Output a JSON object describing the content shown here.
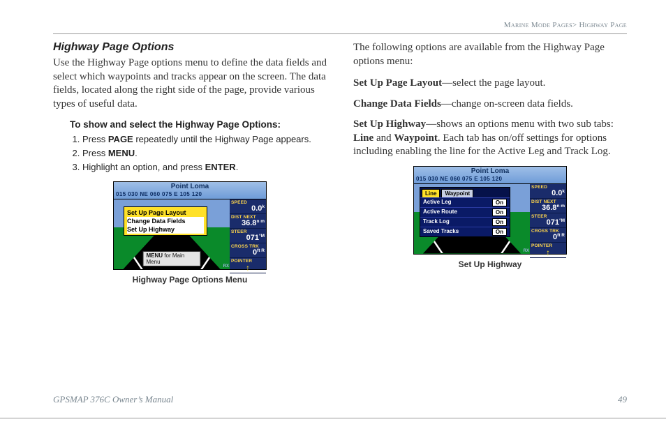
{
  "header": {
    "breadcrumb_left": "Marine Mode Pages",
    "breadcrumb_sep": ">",
    "breadcrumb_right": "Highway Page"
  },
  "left": {
    "title": "Highway Page Options",
    "intro": "Use the Highway Page options menu to define the data fields and select which waypoints and tracks appear on the screen. The data fields, located along the right side of the page, provide various types of useful data.",
    "steps_title": "To show and select the Highway Page Options:",
    "steps": [
      {
        "pre": "Press ",
        "bold": "PAGE",
        "post": " repeatedly until the Highway Page appears."
      },
      {
        "pre": "Press ",
        "bold": "MENU",
        "post": "."
      },
      {
        "pre": "Highlight an option, and press ",
        "bold": "ENTER",
        "post": "."
      }
    ],
    "fig": {
      "title": "Point Loma",
      "compass": "015  030  NE  060  075   E   105  120",
      "menu": [
        "Set Up Page Layout",
        "Change Data Fields",
        "Set Up Highway"
      ],
      "hint_pre": "MENU",
      "hint_post": " for Main Menu",
      "side": [
        {
          "lbl": "SPEED",
          "val": "0.0",
          "unit": "k"
        },
        {
          "lbl": "DIST NEXT",
          "val": "36.8",
          "unit": "n m"
        },
        {
          "lbl": "STEER",
          "val": "071",
          "unit": "°M"
        },
        {
          "lbl": "CROSS TRK",
          "val": "0",
          "unit": "ft R"
        },
        {
          "lbl": "POINTER",
          "arrow": "↑"
        }
      ],
      "rx": "RX",
      "caption": "Highway Page Options Menu"
    }
  },
  "right": {
    "intro": "The following options are available from the Highway Page options menu:",
    "options": [
      {
        "name_bold": "Set Up Page Layout",
        "rest": "—select the page layout."
      },
      {
        "name_bold": "Change Data Fields",
        "rest": "—change on-screen data fields."
      }
    ],
    "setup_highway": {
      "name_bold": "Set Up Highway",
      "pre": "—shows an options menu with two sub tabs: ",
      "b1": "Line",
      "mid": " and ",
      "b2": "Waypoint",
      "post": ". Each tab has on/off settings for options including enabling the line for the Active Leg and Track Log."
    },
    "fig": {
      "title": "Point Loma",
      "compass": "015  030  NE  060  075   E   105  120",
      "tabs": {
        "active": "Line",
        "inactive": "Waypoint"
      },
      "rows": [
        {
          "name": "Active Leg",
          "val": "On"
        },
        {
          "name": "Active Route",
          "val": "On"
        },
        {
          "name": "Track Log",
          "val": "On"
        },
        {
          "name": "Saved Tracks",
          "val": "On"
        }
      ],
      "side": [
        {
          "lbl": "SPEED",
          "val": "0.0",
          "unit": "k"
        },
        {
          "lbl": "DIST NEXT",
          "val": "36.8",
          "unit": "n m"
        },
        {
          "lbl": "STEER",
          "val": "071",
          "unit": "°M"
        },
        {
          "lbl": "CROSS TRK",
          "val": "0",
          "unit": "ft R"
        },
        {
          "lbl": "POINTER",
          "arrow": "↑"
        }
      ],
      "rx": "RX",
      "caption": "Set Up Highway"
    }
  },
  "footer": {
    "left": "GPSMAP 376C Owner’s Manual",
    "right": "49"
  }
}
